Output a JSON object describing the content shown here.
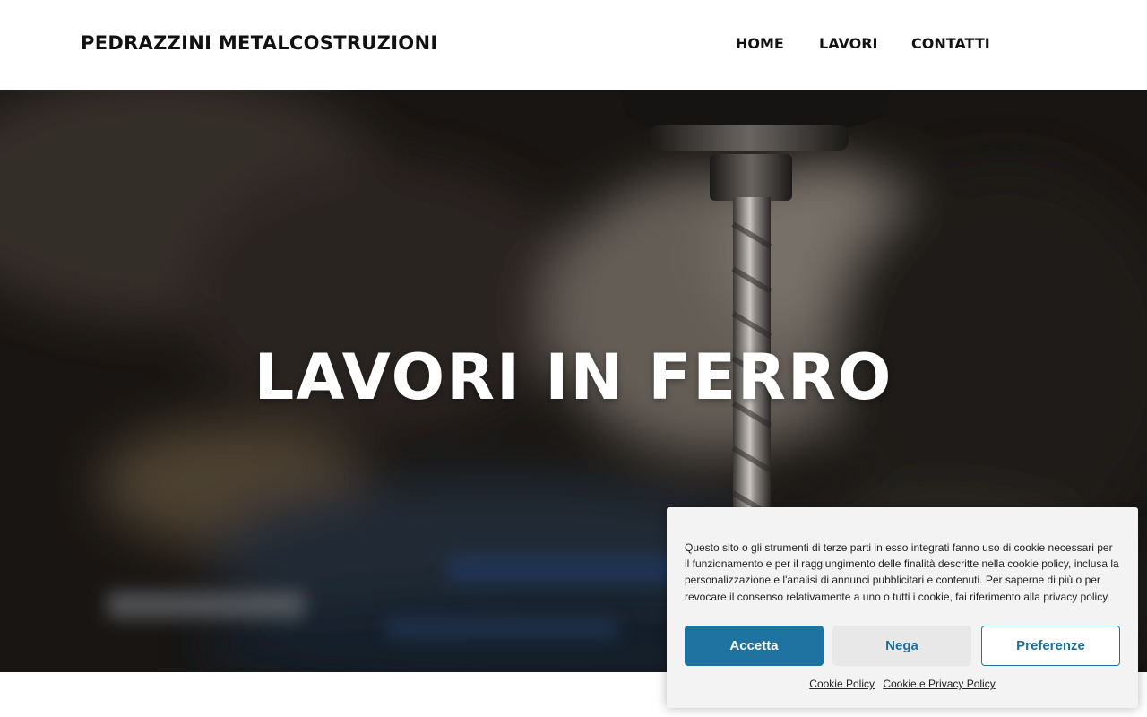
{
  "header": {
    "logo": "PEDRAZZINI METALCOSTRUZIONI",
    "nav": [
      {
        "label": "HOME"
      },
      {
        "label": "LAVORI"
      },
      {
        "label": "CONTATTI"
      }
    ]
  },
  "hero": {
    "title": "LAVORI IN FERRO"
  },
  "cookie_banner": {
    "message": "Questo sito o gli strumenti di terze parti in esso integrati fanno uso di cookie necessari per il funzionamento e per il raggiungimento delle finalità descritte nella cookie policy, inclusa la personalizzazione e l'analisi di annunci pubblicitari e contenuti. Per saperne di più o per revocare il consenso relativamente a uno o tutti i cookie, fai riferimento alla privacy policy.",
    "accept_label": "Accetta",
    "deny_label": "Nega",
    "preferences_label": "Preferenze",
    "links": [
      {
        "label": "Cookie Policy"
      },
      {
        "label": "Cookie e Privacy Policy"
      }
    ],
    "accent_color": "#1e73a0"
  }
}
